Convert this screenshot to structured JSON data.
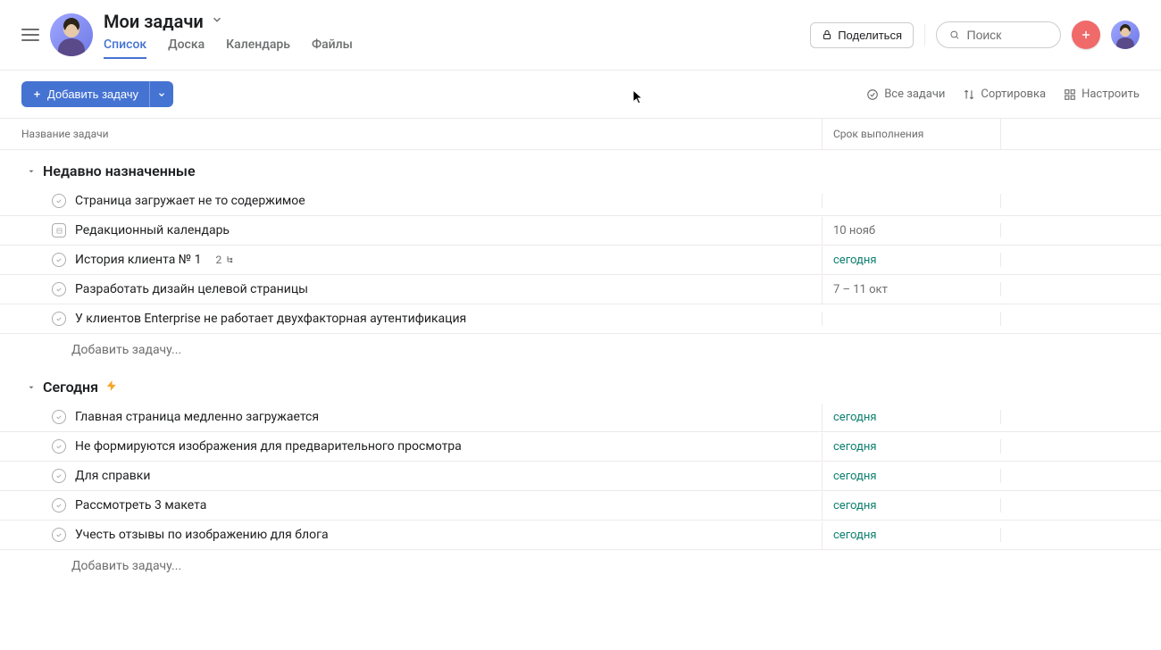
{
  "header": {
    "title": "Мои задачи",
    "tabs": [
      "Список",
      "Доска",
      "Календарь",
      "Файлы"
    ],
    "active_tab": 0,
    "share_label": "Поделиться",
    "search_placeholder": "Поиск"
  },
  "toolbar": {
    "add_task_label": "Добавить задачу",
    "all_tasks_label": "Все задачи",
    "sort_label": "Сортировка",
    "customize_label": "Настроить"
  },
  "columns": {
    "name": "Название задачи",
    "due": "Срок выполнения"
  },
  "sections": [
    {
      "title": "Недавно назначенные",
      "lightning": false,
      "rows": [
        {
          "type": "task",
          "name": "Страница загружает не то содержимое",
          "due": "",
          "due_class": ""
        },
        {
          "type": "project",
          "name": "Редакционный календарь",
          "due": "10 нояб",
          "due_class": ""
        },
        {
          "type": "task",
          "name": "История клиента № 1",
          "subtasks": "2",
          "due": "сегодня",
          "due_class": "due-today"
        },
        {
          "type": "task",
          "name": "Разработать дизайн целевой страницы",
          "due": "7 – 11 окт",
          "due_class": ""
        },
        {
          "type": "task",
          "name": "У клиентов Enterprise не работает двухфакторная аутентификация",
          "due": "",
          "due_class": ""
        }
      ],
      "add_placeholder": "Добавить задачу..."
    },
    {
      "title": "Сегодня",
      "lightning": true,
      "rows": [
        {
          "type": "task",
          "name": "Главная страница медленно загружается",
          "due": "сегодня",
          "due_class": "due-today"
        },
        {
          "type": "task",
          "name": "Не формируются изображения для предварительного просмотра",
          "due": "сегодня",
          "due_class": "due-today"
        },
        {
          "type": "task",
          "name": "Для справки",
          "due": "сегодня",
          "due_class": "due-today"
        },
        {
          "type": "task",
          "name": "Рассмотреть 3 макета",
          "due": "сегодня",
          "due_class": "due-today"
        },
        {
          "type": "task",
          "name": "Учесть отзывы по изображению для блога",
          "due": "сегодня",
          "due_class": "due-today"
        }
      ],
      "add_placeholder": "Добавить задачу..."
    }
  ]
}
